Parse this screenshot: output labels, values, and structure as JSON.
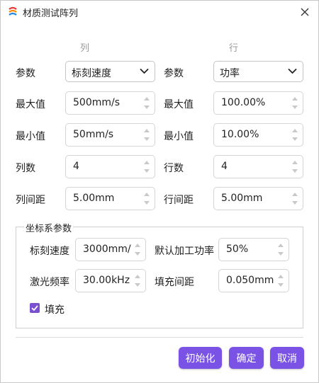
{
  "window": {
    "title": "材质测试阵列"
  },
  "columns": {
    "left": "列",
    "right": "行"
  },
  "left": {
    "param_label": "参数",
    "param_value": "标刻速度",
    "max_label": "最大值",
    "max_value": "500mm/s",
    "min_label": "最小值",
    "min_value": "50mm/s",
    "count_label": "列数",
    "count_value": "4",
    "spacing_label": "列间距",
    "spacing_value": "5.00mm"
  },
  "right": {
    "param_label": "参数",
    "param_value": "功率",
    "max_label": "最大值",
    "max_value": "100.00%",
    "min_label": "最小值",
    "min_value": "10.00%",
    "count_label": "行数",
    "count_value": "4",
    "spacing_label": "行间距",
    "spacing_value": "5.00mm"
  },
  "group": {
    "title": "坐标系参数",
    "speed_label": "标刻速度",
    "speed_value": "3000mm/",
    "power_label": "默认加工功率",
    "power_value": "50%",
    "freq_label": "激光频率",
    "freq_value": "30.00kHz",
    "fill_spacing_label": "填充间距",
    "fill_spacing_value": "0.050mm",
    "fill_label": "填充",
    "fill_checked": true
  },
  "buttons": {
    "init": "初始化",
    "ok": "确定",
    "cancel": "取消"
  },
  "colors": {
    "accent": "#7b52e6",
    "checkbox": "#7a4fd0"
  },
  "icons": {
    "app": "app-logo-icon",
    "close": "close-icon",
    "dropdown": "chevron-down-icon",
    "check": "check-icon"
  }
}
